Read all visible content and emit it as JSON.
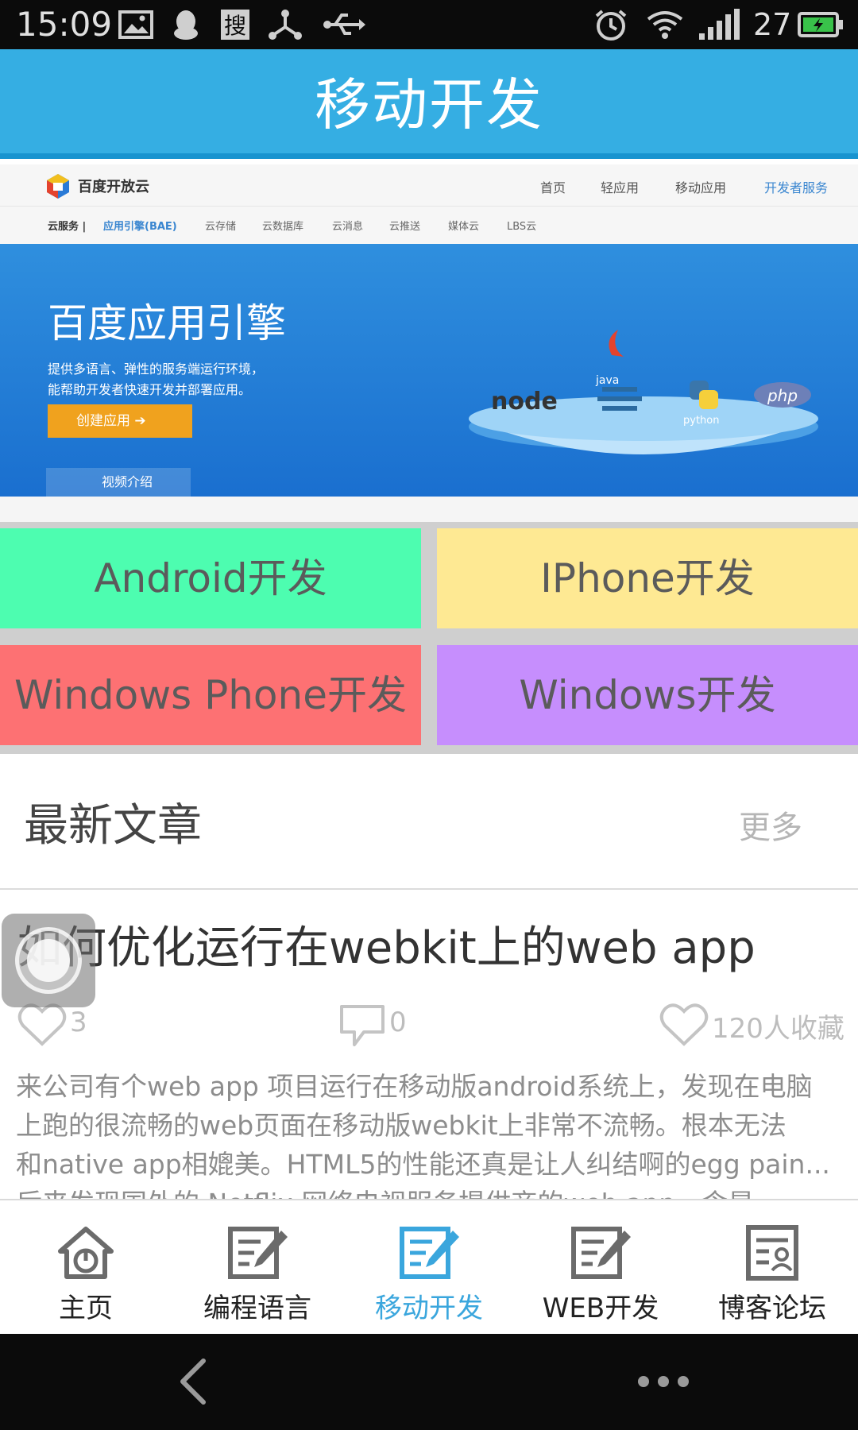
{
  "status_bar": {
    "time": "15:09",
    "battery_level": "27",
    "icons": [
      "image-icon",
      "qq-penguin-icon",
      "sogou-search-icon",
      "share-node-icon",
      "usb-icon",
      "alarm-icon",
      "wifi-icon",
      "signal-icon",
      "battery-icon"
    ]
  },
  "header": {
    "title": "移动开发"
  },
  "banner": {
    "brand": "百度开放云",
    "nav": [
      "首页",
      "轻应用",
      "移动应用",
      "开发者服务"
    ],
    "subnav": [
      "云服务 |",
      "应用引擎(BAE)",
      "云存储",
      "云数据库",
      "云消息",
      "云推送",
      "媒体云",
      "LBS云"
    ],
    "headline": "百度应用引擎",
    "desc_line1": "提供多语言、弹性的服务端运行环境，",
    "desc_line2": "能帮助开发者快速开发并部署应用。",
    "cta": "创建应用",
    "video": "视频介绍",
    "tech_logos": [
      "node",
      "java",
      "python",
      "php"
    ]
  },
  "categories": [
    {
      "label": "Android开发",
      "color": "#4dfdb0"
    },
    {
      "label": "IPhone开发",
      "color": "#fee993"
    },
    {
      "label": "Windows Phone开发",
      "color": "#fd7173"
    },
    {
      "label": "Windows开发",
      "color": "#c68efd"
    }
  ],
  "latest": {
    "title": "最新文章",
    "more": "更多"
  },
  "article": {
    "title": "如何优化运行在webkit上的web app",
    "likes": "3",
    "comments": "0",
    "favorites": "120人收藏",
    "summary_lines": [
      "来公司有个web app 项目运行在移动版android系统上，发现在电脑",
      "上跑的很流畅的web页面在移动版webkit上非常不流畅。根本无法",
      "和native app相媲美。HTML5的性能还真是让人纠结啊的egg pain...",
      "后来发现国外的 Netflix 网络电视服务提供商的web app，含是"
    ]
  },
  "tabs": [
    {
      "label": "主页",
      "icon": "home-icon",
      "active": false
    },
    {
      "label": "编程语言",
      "icon": "edit-icon",
      "active": false
    },
    {
      "label": "移动开发",
      "icon": "edit-icon",
      "active": true
    },
    {
      "label": "WEB开发",
      "icon": "edit-icon",
      "active": false
    },
    {
      "label": "博客论坛",
      "icon": "profile-doc-icon",
      "active": false
    }
  ],
  "colors": {
    "header_bg": "#35aee3",
    "active_tab": "#3aa6dd",
    "inactive_tab_icon": "#6b6b6b"
  }
}
